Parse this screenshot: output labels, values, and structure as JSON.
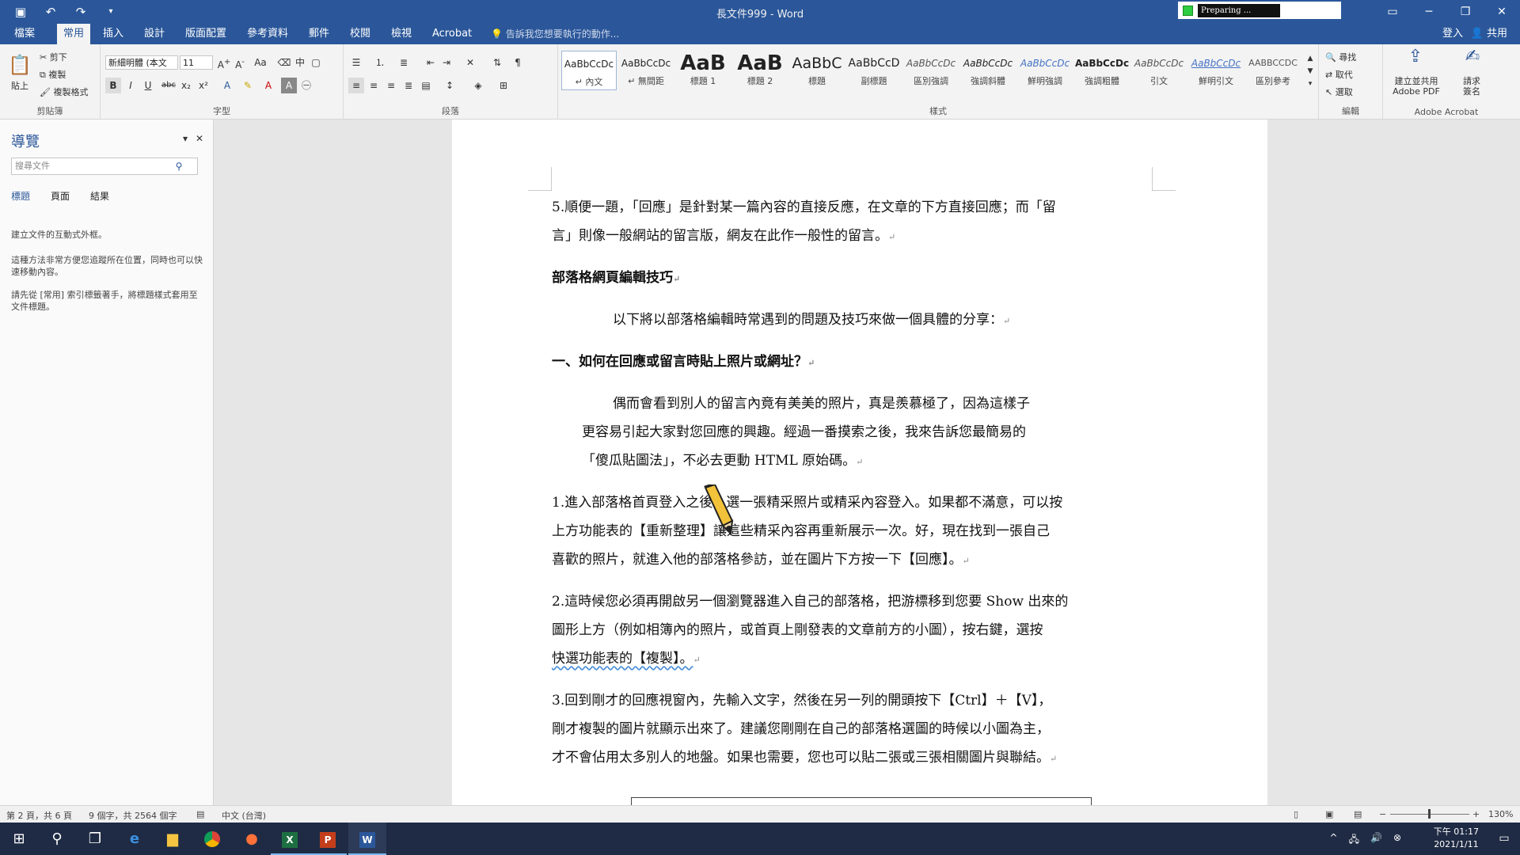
{
  "titlebar": {
    "title": "長文件999 - Word",
    "status_label": "Preparing ...",
    "qat_icons": [
      "save-icon",
      "undo-icon",
      "redo-icon",
      "customize-icon"
    ]
  },
  "tabs": [
    {
      "label": "檔案"
    },
    {
      "label": "常用"
    },
    {
      "label": "插入"
    },
    {
      "label": "設計"
    },
    {
      "label": "版面配置"
    },
    {
      "label": "參考資料"
    },
    {
      "label": "郵件"
    },
    {
      "label": "校閱"
    },
    {
      "label": "檢視"
    },
    {
      "label": "Acrobat"
    }
  ],
  "tell_me": "告訴我您想要執行的動作...",
  "signin": "登入",
  "share": "共用",
  "ribbon": {
    "clipboard": {
      "paste": "貼上",
      "cut": "剪下",
      "copy": "複製",
      "format_painter": "複製格式",
      "label": "剪貼簿"
    },
    "font": {
      "font_name": "新細明體 (本文",
      "font_size": "11",
      "label": "字型"
    },
    "paragraph": {
      "label": "段落"
    },
    "styles": {
      "label": "樣式",
      "items": [
        {
          "preview": "AaBbCcDc",
          "name": "↵ 內文"
        },
        {
          "preview": "AaBbCcDc",
          "name": "↵ 無間距"
        },
        {
          "preview": "AaB",
          "name": "標題 1"
        },
        {
          "preview": "AaB",
          "name": "標題 2"
        },
        {
          "preview": "AaBbC",
          "name": "標題"
        },
        {
          "preview": "AaBbCcD",
          "name": "副標題"
        },
        {
          "preview": "AaBbCcDc",
          "name": "區別強調"
        },
        {
          "preview": "AaBbCcDc",
          "name": "強調斜體"
        },
        {
          "preview": "AaBbCcDc",
          "name": "鮮明強調"
        },
        {
          "preview": "AaBbCcDc",
          "name": "強調粗體"
        },
        {
          "preview": "AaBbCcDc",
          "name": "引文"
        },
        {
          "preview": "AaBbCcDc",
          "name": "鮮明引文"
        },
        {
          "preview": "AABBCCDC",
          "name": "區別參考"
        }
      ]
    },
    "editing": {
      "find": "尋找",
      "replace": "取代",
      "select": "選取",
      "label": "編輯"
    },
    "acrobat": {
      "create": "建立並共用",
      "create2": "Adobe PDF",
      "request": "請求",
      "request2": "簽名",
      "label": "Adobe Acrobat"
    }
  },
  "navpane": {
    "title": "導覽",
    "search_placeholder": "搜尋文件",
    "tabs": [
      "標題",
      "頁面",
      "結果"
    ],
    "text1": "建立文件的互動式外框。",
    "text2": "這種方法非常方便您追蹤所在位置，同時也可以快速移動內容。",
    "text3": "請先從 [常用] 索引標籤著手，將標題樣式套用至文件標題。"
  },
  "document": {
    "p1a": "5.順便一題，「回應」是針對某一篇內容的直接反應，在文章的下方直接回應；而「留",
    "p1b": "言」則像一般網站的留言版，網友在此作一般性的留言。",
    "h1": "部落格網頁編輯技巧",
    "p2": "以下將以部落格編輯時常遇到的問題及技巧來做一個具體的分享：",
    "h2": "一、如何在回應或留言時貼上照片或網址？",
    "p3a": "偶而會看到別人的留言內竟有美美的照片，真是羨慕極了，因為這樣子",
    "p3b": "更容易引起大家對您回應的興趣。經過一番摸索之後，我來告訴您最簡易的",
    "p3c": "「傻瓜貼圖法」，不必去更動 HTML 原始碼。",
    "p4a": "1.進入部落格首頁登入之後，選一張精采照片或精采內容登入。如果都不滿意，可以按",
    "p4b": "上方功能表的【重新整理】讓這些精采內容再重新展示一次。好，現在找到一張自己",
    "p4c": "喜歡的照片，就進入他的部落格參訪，並在圖片下方按一下【回應】。",
    "p5a": "2.這時候您必須再開啟另一個瀏覽器進入自己的部落格，把游標移到您要 Show 出來的",
    "p5b": "圖形上方（例如相簿內的照片，或首頁上剛發表的文章前方的小圖），按右鍵，選按",
    "p5c": "快選功能表的【複製】。",
    "p6a": "3.回到剛才的回應視窗內，先輸入文字，然後在另一列的開頭按下【Ctrl】＋【V】，",
    "p6b": "剛才複製的圖片就顯示出來了。建議您剛剛在自己的部落格選圖的時候以小圖為主，",
    "p6c": "才不會佔用太多別人的地盤。如果也需要，您也可以貼二張或三張相關圖片與聯結。"
  },
  "statusbar": {
    "page": "第 2 頁，共 6 頁",
    "words": "9 個字，共 2564 個字",
    "lang": "中文 (台灣)",
    "zoom": "130%"
  },
  "taskbar": {
    "time": "下午 01:17",
    "date": "2021/1/11"
  }
}
